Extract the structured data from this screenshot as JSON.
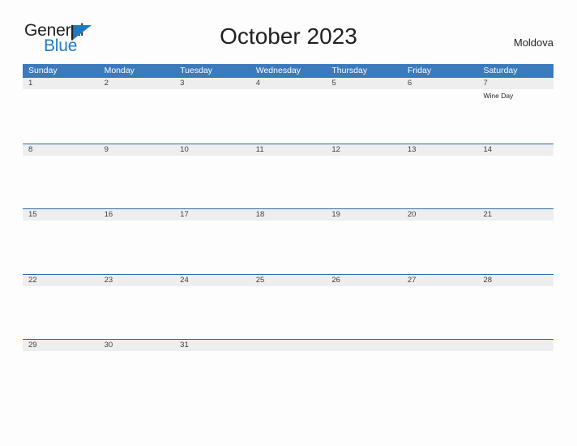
{
  "brand": {
    "word_one": "General",
    "word_two": "Blue",
    "mark": "triangle-logo-icon",
    "color_text": "#231f20",
    "color_blue": "#1f7ac4"
  },
  "header": {
    "title": "October 2023",
    "country": "Moldova"
  },
  "theme": {
    "header_blue": "#3a7abd",
    "row_rule": "#2e6da4",
    "band_gray": "#eeeeee",
    "page_background": "#fdfdfd"
  },
  "calendar": {
    "weekdays": [
      "Sunday",
      "Monday",
      "Tuesday",
      "Wednesday",
      "Thursday",
      "Friday",
      "Saturday"
    ],
    "weeks": [
      {
        "days": [
          {
            "num": "1",
            "events": []
          },
          {
            "num": "2",
            "events": []
          },
          {
            "num": "3",
            "events": []
          },
          {
            "num": "4",
            "events": []
          },
          {
            "num": "5",
            "events": []
          },
          {
            "num": "6",
            "events": []
          },
          {
            "num": "7",
            "events": [
              "Wine Day"
            ]
          }
        ]
      },
      {
        "days": [
          {
            "num": "8",
            "events": []
          },
          {
            "num": "9",
            "events": []
          },
          {
            "num": "10",
            "events": []
          },
          {
            "num": "11",
            "events": []
          },
          {
            "num": "12",
            "events": []
          },
          {
            "num": "13",
            "events": []
          },
          {
            "num": "14",
            "events": []
          }
        ]
      },
      {
        "days": [
          {
            "num": "15",
            "events": []
          },
          {
            "num": "16",
            "events": []
          },
          {
            "num": "17",
            "events": []
          },
          {
            "num": "18",
            "events": []
          },
          {
            "num": "19",
            "events": []
          },
          {
            "num": "20",
            "events": []
          },
          {
            "num": "21",
            "events": []
          }
        ]
      },
      {
        "days": [
          {
            "num": "22",
            "events": []
          },
          {
            "num": "23",
            "events": []
          },
          {
            "num": "24",
            "events": []
          },
          {
            "num": "25",
            "events": []
          },
          {
            "num": "26",
            "events": []
          },
          {
            "num": "27",
            "events": []
          },
          {
            "num": "28",
            "events": []
          }
        ]
      },
      {
        "days": [
          {
            "num": "29",
            "events": []
          },
          {
            "num": "30",
            "events": []
          },
          {
            "num": "31",
            "events": []
          },
          {
            "num": "",
            "events": []
          },
          {
            "num": "",
            "events": []
          },
          {
            "num": "",
            "events": []
          },
          {
            "num": "",
            "events": []
          }
        ]
      }
    ]
  }
}
